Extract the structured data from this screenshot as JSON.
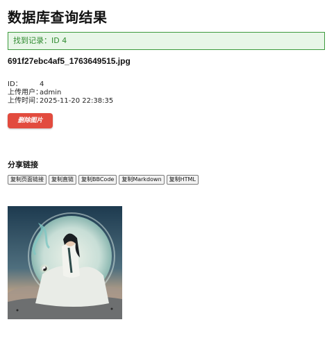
{
  "page": {
    "title": "数据库查询结果"
  },
  "alert": {
    "text": "找到记录：ID 4"
  },
  "record": {
    "filename": "691f27ebc4af5_1763649515.jpg",
    "id_label": "ID：",
    "id_value": "4",
    "user_label": "上传用户：",
    "user_value": "admin",
    "time_label": "上传时间：",
    "time_value": "2025-11-20 22:38:35"
  },
  "actions": {
    "delete_label": "删除图片"
  },
  "share": {
    "heading": "分享链接",
    "buttons": [
      "复制页面链接",
      "复制直链",
      "复制BBCode",
      "复制Markdown",
      "复制HTML"
    ]
  },
  "colors": {
    "alert_border": "#3c9a3c",
    "alert_bg": "#e8f6e8",
    "delete_bg": "#e24b3e"
  }
}
